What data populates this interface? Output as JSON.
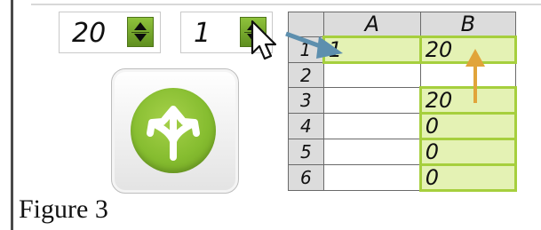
{
  "spinners": [
    {
      "value": "20"
    },
    {
      "value": "1"
    }
  ],
  "action_icon": "split-arrows-icon",
  "sheet": {
    "columns": [
      "A",
      "B"
    ],
    "rows": [
      {
        "row": "1",
        "a": "1",
        "b": "20",
        "highlight_a": true,
        "highlight_b": true
      },
      {
        "row": "2",
        "a": "",
        "b": "",
        "highlight_a": false,
        "highlight_b": false
      },
      {
        "row": "3",
        "a": "",
        "b": "20",
        "highlight_a": false,
        "highlight_b": true
      },
      {
        "row": "4",
        "a": "",
        "b": "0",
        "highlight_a": false,
        "highlight_b": true
      },
      {
        "row": "5",
        "a": "",
        "b": "0",
        "highlight_a": false,
        "highlight_b": true
      },
      {
        "row": "6",
        "a": "",
        "b": "0",
        "highlight_a": false,
        "highlight_b": true
      }
    ]
  },
  "colors": {
    "accent_green": "#86bd30",
    "highlight_fill": "#e4f2b4",
    "blue_arrow": "#5d8fae",
    "orange_arrow": "#e1a43a"
  },
  "caption": "Figure 3"
}
